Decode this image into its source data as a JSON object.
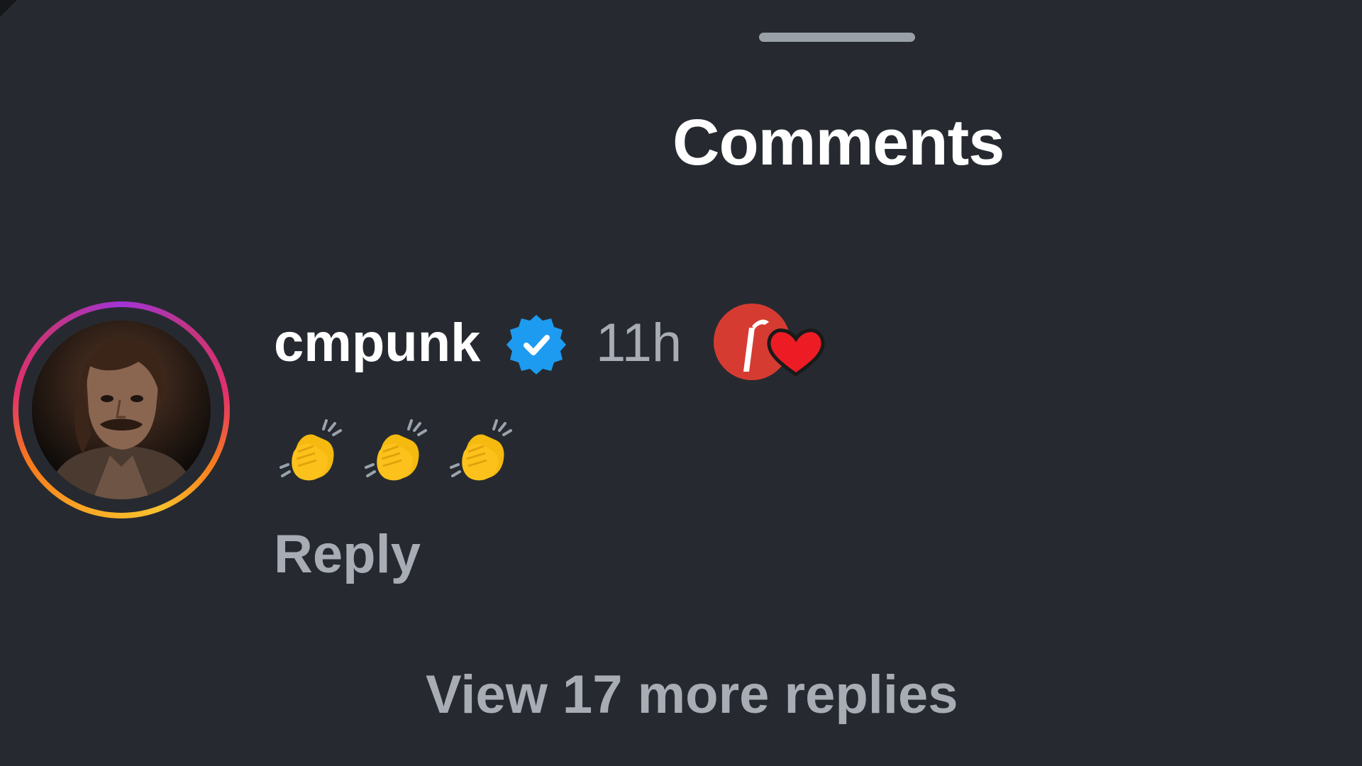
{
  "sheet": {
    "title": "Comments"
  },
  "comment": {
    "username": "cmpunk",
    "verified": true,
    "timestamp": "11h",
    "text_emoji": [
      "clapping-hands",
      "clapping-hands",
      "clapping-hands"
    ],
    "reply_label": "Reply",
    "view_more_label": "View 17 more replies",
    "badge": "creator-liked-heart"
  },
  "colors": {
    "background": "#262a30",
    "primary_text": "#ffffff",
    "secondary_text": "#a8adb5",
    "verified_blue": "#1d9bf0",
    "heart_red": "#ed1c24",
    "badge_red": "#d63b32"
  }
}
